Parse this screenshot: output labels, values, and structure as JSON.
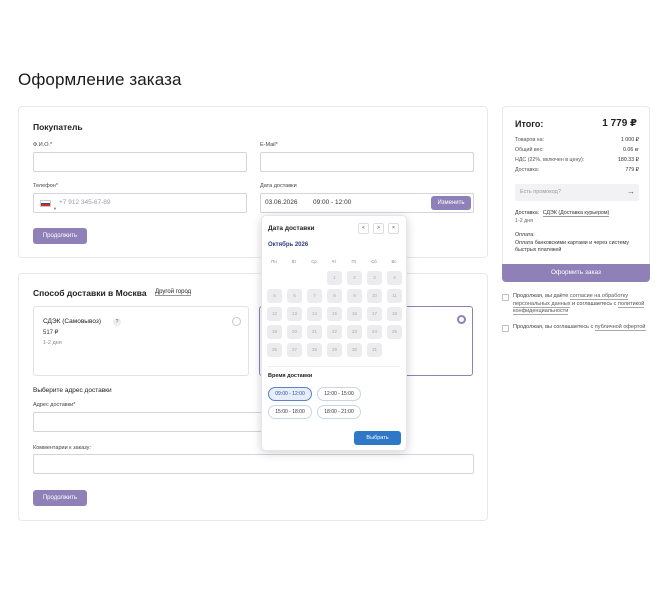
{
  "page": {
    "title": "Оформление заказа"
  },
  "buyer": {
    "title": "Покупатель",
    "name_label": "Ф.И.О.*",
    "email_label": "E-Mail*",
    "phone_label": "Телефон*",
    "phone_placeholder": "+7 912 345-67-89",
    "date_label": "Дата доставки",
    "date_value": "03.06.2026",
    "time_value": "09:00 - 12:00",
    "change_button": "Изменить",
    "continue_button": "Продолжить"
  },
  "delivery": {
    "title": "Способ доставки в Москва",
    "other_city": "Другой город",
    "option1": {
      "name": "СДЭК (Самовывоз)",
      "info_icon": "?",
      "price": "517 ₽",
      "days": "1-2 дня"
    },
    "address_section": "Выберите адрес доставки",
    "address_label": "Адрес доставки*",
    "comment_label": "Комментарии к заказу:",
    "continue_button": "Продолжить"
  },
  "summary": {
    "title": "Итого:",
    "total": "1 779 ₽",
    "rows": [
      {
        "label": "Товаров на:",
        "value": "1 000 ₽"
      },
      {
        "label": "Общий вес:",
        "value": "0.06 кг"
      },
      {
        "label": "НДС (22%, включен в цену):",
        "value": "180.33 ₽"
      },
      {
        "label": "Доставка:",
        "value": "779 ₽"
      }
    ],
    "promo_placeholder": "Есть промокод?",
    "promo_arrow": "→",
    "delivery_label": "Доставка:",
    "delivery_value": "СДЭК (Доставка курьером)",
    "delivery_days": "1-2 дня",
    "payment_label": "Оплата:",
    "payment_value": "Оплата банковскими картами и через систему быстрых платежей",
    "checkout_button": "Оформить заказ",
    "consent1_a": "Продолжая, вы даёте ",
    "consent1_link": "согласие на обработку персональных данных",
    "consent1_b": " и соглашаетесь с ",
    "consent1_link2": "политикой конфиденциальности",
    "consent2_a": "Продолжая, вы соглашаетесь с ",
    "consent2_link": "публичной офертой"
  },
  "calendar": {
    "title": "Дата доставки",
    "prev": "<",
    "next": ">",
    "close": "×",
    "month": "Октябрь 2026",
    "weekdays": [
      "Пн",
      "Вт",
      "Ср",
      "Чт",
      "Пт",
      "Сб",
      "Вс"
    ],
    "days": [
      "1",
      "2",
      "3",
      "4",
      "5",
      "6",
      "7",
      "8",
      "9",
      "10",
      "11",
      "12",
      "13",
      "14",
      "15",
      "16",
      "17",
      "18",
      "19",
      "20",
      "21",
      "22",
      "23",
      "24",
      "25",
      "26",
      "27",
      "28",
      "29",
      "30",
      "31"
    ],
    "first_weekday_index": 3,
    "time_title": "Время доставки",
    "slots": [
      "09:00 - 12:00",
      "12:00 - 15:00",
      "15:00 - 18:00",
      "18:00 - 21:00"
    ],
    "choose_button": "Выбрать"
  },
  "colors": {
    "accent": "#8f80b8",
    "primary_blue": "#2f78c8"
  }
}
